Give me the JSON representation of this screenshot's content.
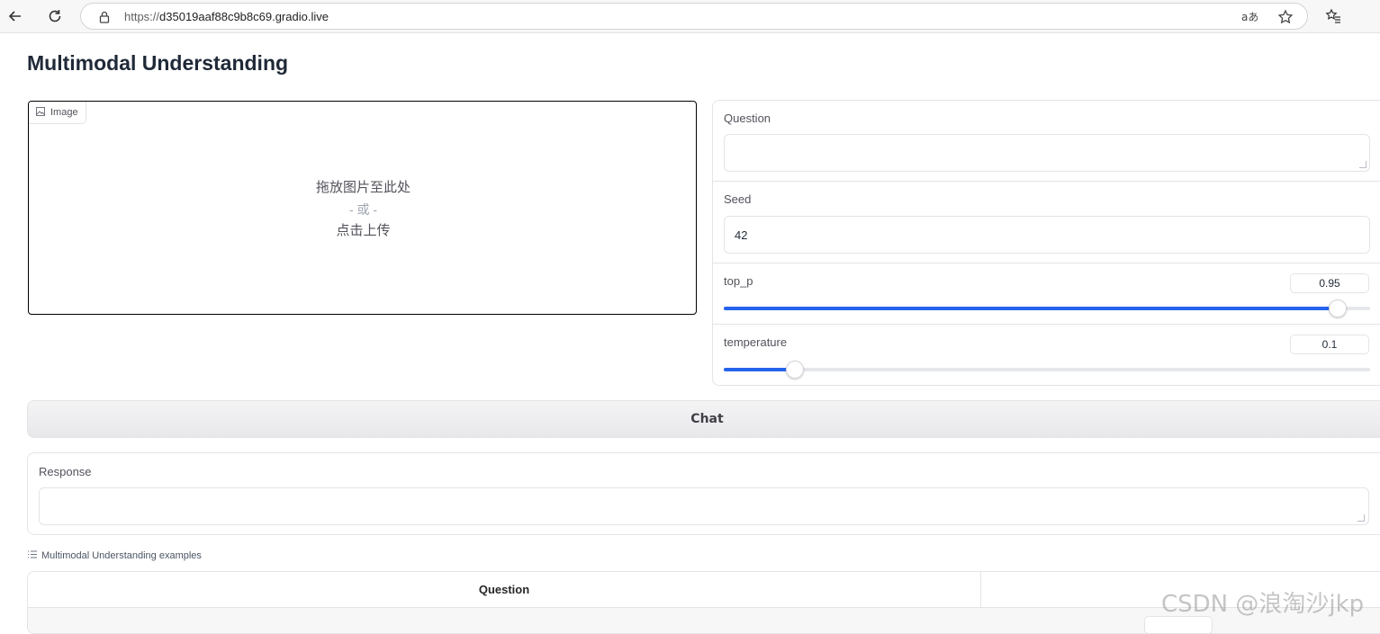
{
  "browser": {
    "url_protocol": "https://",
    "url_host": "d35019aaf88c9b8c69.gradio.live",
    "icons": [
      "back-arrow-icon",
      "reload-icon",
      "lock-icon",
      "read-aloud-icon",
      "star-icon",
      "favorites-icon"
    ]
  },
  "page": {
    "title": "Multimodal Understanding"
  },
  "image_input": {
    "label": "Image",
    "drop_line1": "拖放图片至此处",
    "drop_or": "- 或 -",
    "drop_line2": "点击上传"
  },
  "params": {
    "question_label": "Question",
    "question_value": "",
    "seed_label": "Seed",
    "seed_value": "42",
    "top_p_label": "top_p",
    "top_p_value": "0.95",
    "top_p_fraction": 0.95,
    "temperature_label": "temperature",
    "temperature_value": "0.1",
    "temperature_fraction": 0.11
  },
  "chat_button": "Chat",
  "response": {
    "label": "Response",
    "value": ""
  },
  "examples": {
    "label": "Multimodal Understanding examples",
    "columns": [
      "Question",
      ""
    ]
  },
  "watermark": "CSDN @浪淘沙jkp",
  "colors": {
    "accent": "#2563eb",
    "border": "#e4e4e7"
  }
}
